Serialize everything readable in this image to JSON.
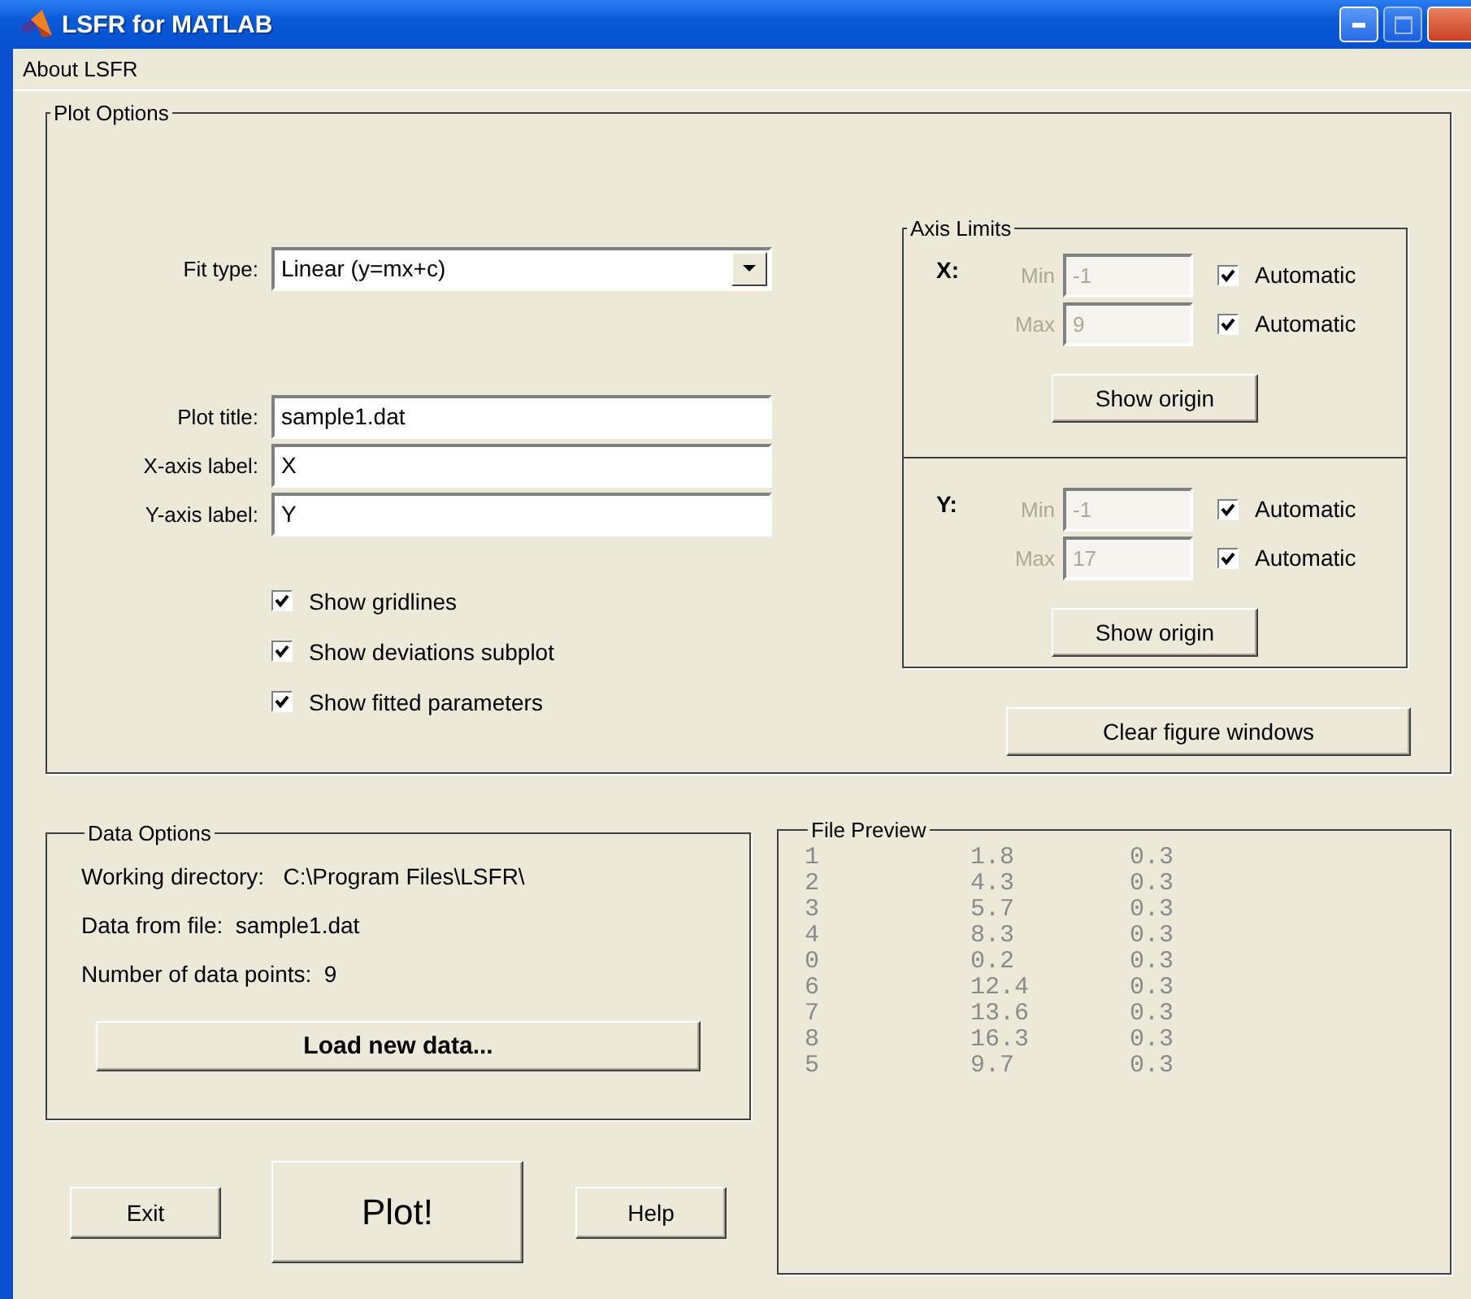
{
  "window": {
    "title": "LSFR for MATLAB"
  },
  "menu": [
    {
      "label": "About LSFR"
    }
  ],
  "plot_options": {
    "title": "Plot Options",
    "fit_type": {
      "label": "Fit type:",
      "value": "Linear (y=mx+c)"
    },
    "fields": [
      {
        "label": "Plot title:",
        "value": "sample1.dat"
      },
      {
        "label": "X-axis label:",
        "value": "X"
      },
      {
        "label": "Y-axis label:",
        "value": "Y"
      }
    ],
    "checkboxes": [
      {
        "label": "Show gridlines",
        "checked": true
      },
      {
        "label": "Show deviations subplot",
        "checked": true
      },
      {
        "label": "Show fitted parameters",
        "checked": true
      }
    ],
    "axis_limits": {
      "title": "Axis Limits",
      "axes": [
        {
          "name": "X:",
          "limits": [
            {
              "label": "Min",
              "value": "-1",
              "disabled": true,
              "automatic": {
                "label": "Automatic",
                "checked": true
              }
            },
            {
              "label": "Max",
              "value": "9",
              "disabled": true,
              "automatic": {
                "label": "Automatic",
                "checked": true
              }
            }
          ],
          "button": "Show origin"
        },
        {
          "name": "Y:",
          "limits": [
            {
              "label": "Min",
              "value": "-1",
              "disabled": true,
              "automatic": {
                "label": "Automatic",
                "checked": true
              }
            },
            {
              "label": "Max",
              "value": "17",
              "disabled": true,
              "automatic": {
                "label": "Automatic",
                "checked": true
              }
            }
          ],
          "button": "Show origin"
        }
      ]
    },
    "clear_button": "Clear figure windows"
  },
  "data_options": {
    "title": "Data Options",
    "lines": [
      {
        "label": "Working directory:",
        "value": "C:\\Program Files\\LSFR\\"
      },
      {
        "label": "Data from file:",
        "value": "sample1.dat"
      },
      {
        "label": "Number of data points:",
        "value": "9"
      }
    ],
    "load_button": "Load new data..."
  },
  "buttons": [
    {
      "label": "Exit",
      "kind": "normal"
    },
    {
      "label": "Plot!",
      "kind": "large"
    },
    {
      "label": "Help",
      "kind": "normal"
    }
  ],
  "file_preview": {
    "title": "File Preview",
    "rows": [
      [
        "1",
        "1.8",
        "0.3"
      ],
      [
        "2",
        "4.3",
        "0.3"
      ],
      [
        "3",
        "5.7",
        "0.3"
      ],
      [
        "4",
        "8.3",
        "0.3"
      ],
      [
        "0",
        "0.2",
        "0.3"
      ],
      [
        "6",
        "12.4",
        "0.3"
      ],
      [
        "7",
        "13.6",
        "0.3"
      ],
      [
        "8",
        "16.3",
        "0.3"
      ],
      [
        "5",
        "9.7",
        "0.3"
      ]
    ]
  }
}
